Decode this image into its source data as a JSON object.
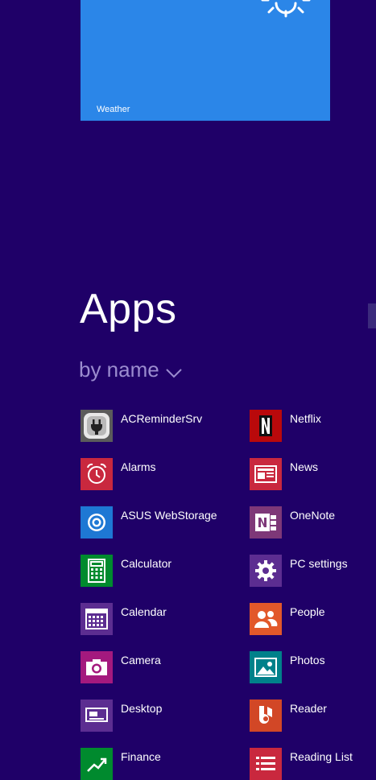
{
  "weather": {
    "label": "Weather"
  },
  "header": {
    "title": "Apps",
    "sort_label": "by name"
  },
  "apps_left": [
    {
      "name": "ACReminderSrv",
      "icon": "plug-icon",
      "color": "#5b5b5b"
    },
    {
      "name": "Alarms",
      "icon": "alarm-clock-icon",
      "color": "#c9283e"
    },
    {
      "name": "ASUS WebStorage",
      "icon": "cloud-sync-icon",
      "color": "#1e78d4"
    },
    {
      "name": "Calculator",
      "icon": "calculator-icon",
      "color": "#008a2e"
    },
    {
      "name": "Calendar",
      "icon": "calendar-icon",
      "color": "#5c2d91"
    },
    {
      "name": "Camera",
      "icon": "camera-icon",
      "color": "#a4197e"
    },
    {
      "name": "Desktop",
      "icon": "desktop-icon",
      "color": "#5c2d91"
    },
    {
      "name": "Finance",
      "icon": "chart-up-icon",
      "color": "#008a2e"
    }
  ],
  "apps_right": [
    {
      "name": "Netflix",
      "icon": "netflix-icon",
      "color": "#b9090b"
    },
    {
      "name": "News",
      "icon": "newspaper-icon",
      "color": "#c9283e"
    },
    {
      "name": "OneNote",
      "icon": "onenote-icon",
      "color": "#7e3878"
    },
    {
      "name": "PC settings",
      "icon": "gear-icon",
      "color": "#5c2d91"
    },
    {
      "name": "People",
      "icon": "people-icon",
      "color": "#e2582a"
    },
    {
      "name": "Photos",
      "icon": "photo-icon",
      "color": "#00818a"
    },
    {
      "name": "Reader",
      "icon": "reader-icon",
      "color": "#d24726"
    },
    {
      "name": "Reading List",
      "icon": "reading-list-icon",
      "color": "#c9283e"
    }
  ]
}
